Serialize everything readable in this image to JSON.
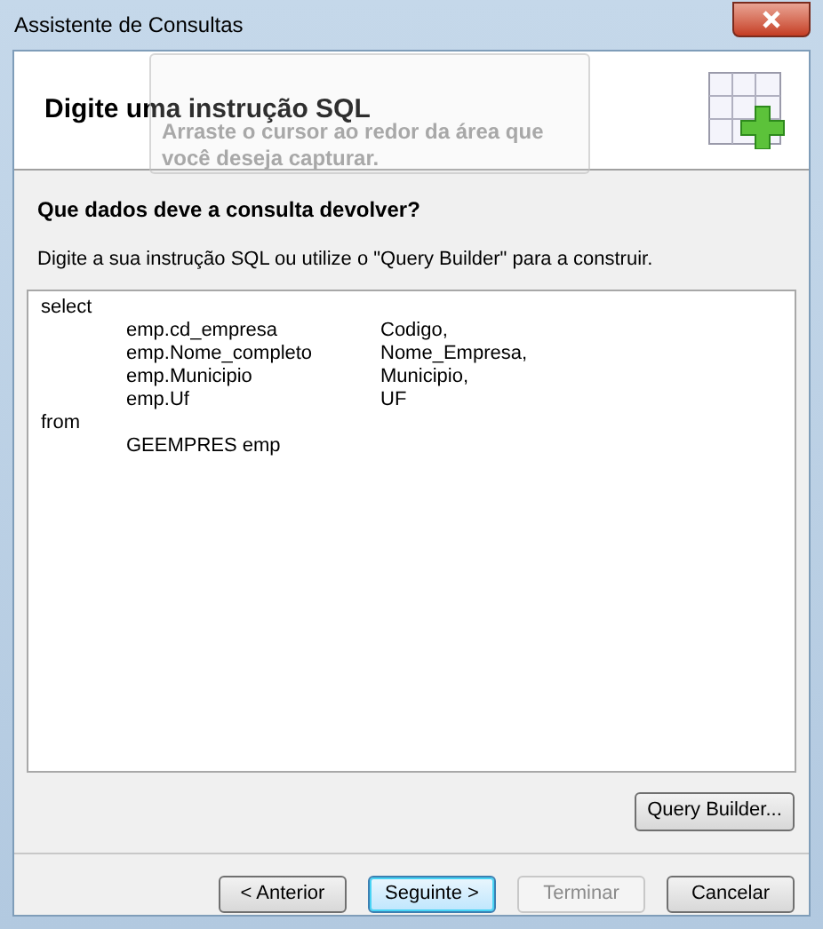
{
  "window": {
    "title": "Assistente de Consultas"
  },
  "header": {
    "title": "Digite uma instrução SQL"
  },
  "capture_overlay": {
    "hint": "Arraste o cursor ao redor da área que você deseja capturar."
  },
  "question": "Que dados deve a consulta devolver?",
  "description": "Digite a sua instrução SQL ou utilize o \"Query Builder\" para a construir.",
  "sql_lines": [
    {
      "kind": "keyword",
      "text": "select"
    },
    {
      "kind": "column",
      "expr": "emp.cd_empresa",
      "alias": "Codigo,"
    },
    {
      "kind": "column",
      "expr": "emp.Nome_completo",
      "alias": "Nome_Empresa,"
    },
    {
      "kind": "column",
      "expr": "emp.Municipio",
      "alias": "Municipio,"
    },
    {
      "kind": "column",
      "expr": "emp.Uf",
      "alias": "UF"
    },
    {
      "kind": "keyword",
      "text": "from"
    },
    {
      "kind": "table",
      "text": "GEEMPRES emp"
    }
  ],
  "query_builder_button": "Query Builder...",
  "buttons": [
    {
      "label": "< Anterior",
      "disabled": false,
      "default": false
    },
    {
      "label": "Seguinte >",
      "disabled": false,
      "default": true
    },
    {
      "label": "Terminar",
      "disabled": true,
      "default": false
    },
    {
      "label": "Cancelar",
      "disabled": false,
      "default": false
    }
  ]
}
